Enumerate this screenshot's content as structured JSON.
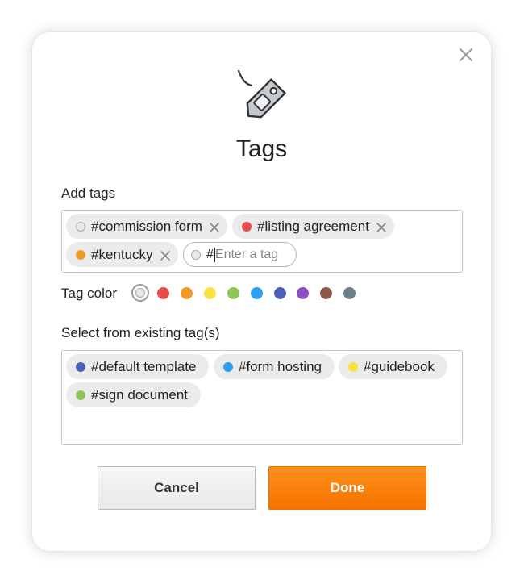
{
  "dialog": {
    "title": "Tags",
    "close_icon": "close-icon",
    "hero_icon": "tag-icon"
  },
  "add_tags": {
    "label": "Add tags",
    "tags": [
      {
        "text": "#commission form",
        "color": "#e8e8e8"
      },
      {
        "text": "#listing agreement",
        "color": "#e94b4b"
      },
      {
        "text": "#kentucky",
        "color": "#f39a24"
      }
    ],
    "input": {
      "value": "#",
      "placeholder": "Enter a tag"
    }
  },
  "tag_color": {
    "label": "Tag color",
    "swatches": [
      "#e8e8e8",
      "#e94b4b",
      "#f39a24",
      "#f6e241",
      "#8ec355",
      "#2d9ef0",
      "#4c5fb6",
      "#8a4fc4",
      "#8a5a4a",
      "#6b7f8c"
    ],
    "selected": "#e8e8e8"
  },
  "existing_tags": {
    "label": "Select from existing tag(s)",
    "tags": [
      {
        "text": "#default template",
        "color": "#4c5fb6"
      },
      {
        "text": "#form hosting",
        "color": "#2d9ef0"
      },
      {
        "text": "#guidebook",
        "color": "#f6e241"
      },
      {
        "text": "#sign document",
        "color": "#8ec355"
      }
    ]
  },
  "buttons": {
    "cancel": "Cancel",
    "done": "Done"
  }
}
